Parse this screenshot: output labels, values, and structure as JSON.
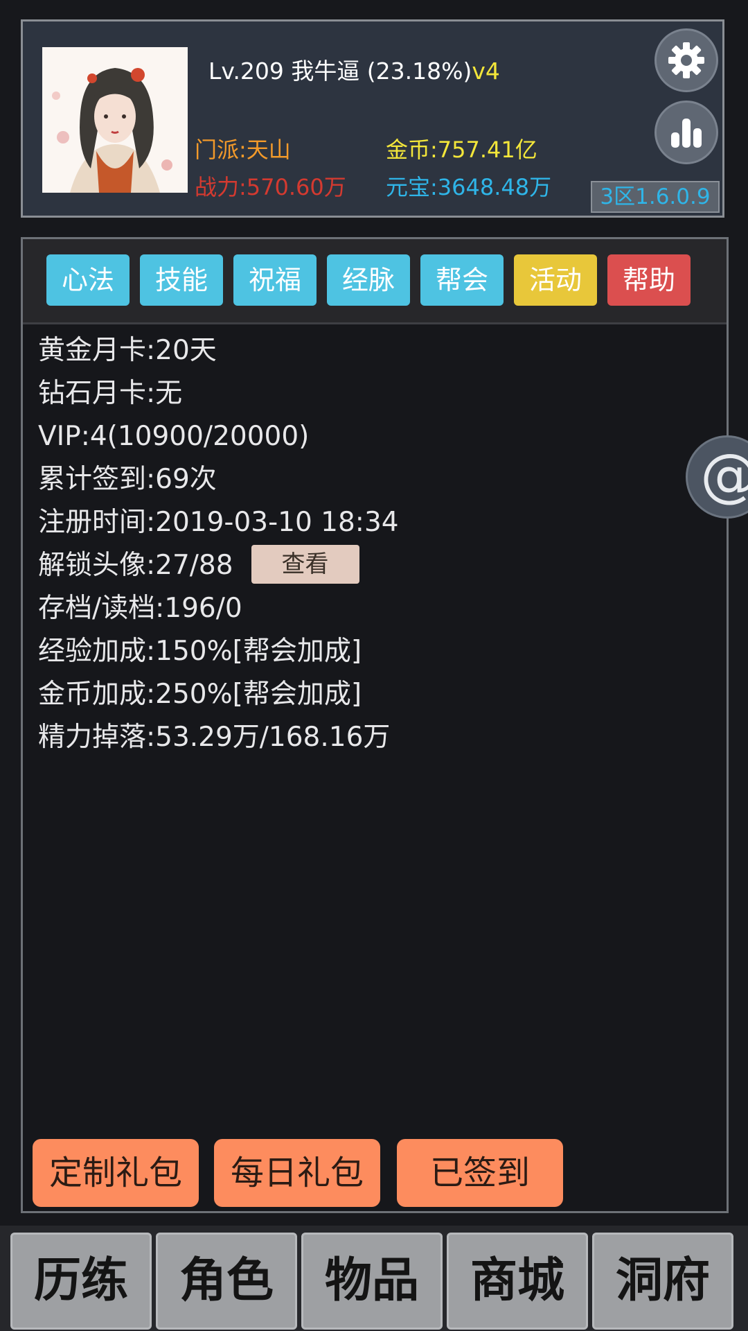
{
  "header": {
    "level_text": "Lv.209 我牛逼 (23.18%)",
    "vip_tag": "v4",
    "sect": "门派:天山",
    "power": "战力:570.60万",
    "gold": "金币:757.41亿",
    "yuanbao": "元宝:3648.48万",
    "version": "3区1.6.0.9",
    "settings_icon": "gear-icon",
    "ranking_icon": "bar-chart-icon"
  },
  "tabs": [
    {
      "label": "心法",
      "color": "#4ec3e2"
    },
    {
      "label": "技能",
      "color": "#4ec3e2"
    },
    {
      "label": "祝福",
      "color": "#4ec3e2"
    },
    {
      "label": "经脉",
      "color": "#4ec3e2"
    },
    {
      "label": "帮会",
      "color": "#4ec3e2"
    },
    {
      "label": "活动",
      "color": "#e8c73a"
    },
    {
      "label": "帮助",
      "color": "#db4f4f"
    }
  ],
  "info": [
    "黄金月卡:20天",
    "钻石月卡:无",
    "VIP:4(10900/20000)",
    "累计签到:69次",
    "注册时间:2019-03-10 18:34",
    "解锁头像:27/88",
    "存档/读档:196/0",
    "经验加成:150%[帮会加成]",
    "金币加成:250%[帮会加成]",
    "精力掉落:53.29万/168.16万"
  ],
  "view_button": "查看",
  "side_button": "@",
  "gifts": [
    "定制礼包",
    "每日礼包",
    "已签到"
  ],
  "nav": [
    "历练",
    "角色",
    "物品",
    "商城",
    "洞府"
  ],
  "colors": {
    "sect": "#f39a2a",
    "power": "#d43a30",
    "gold": "#f3e63a",
    "yuanbao": "#2fb5e8"
  }
}
